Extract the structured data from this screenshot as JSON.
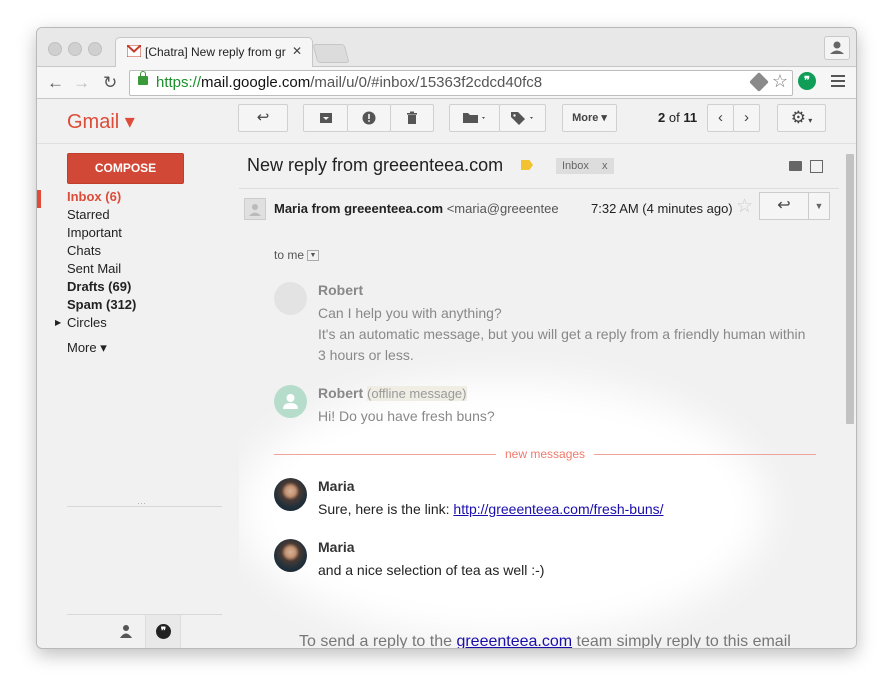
{
  "browser": {
    "tab_title": "[Chatra] New reply from gr",
    "tab_close": "✕",
    "url_scheme": "https://",
    "url_host": "mail.google.com",
    "url_path": "/mail/u/0/#inbox/15363f2cdcd40fc8"
  },
  "gmail": {
    "logo": "Gmail ▾",
    "more_label": "More ▾",
    "count_current": "2",
    "count_of": "of",
    "count_total": "11"
  },
  "sidebar": {
    "compose": "COMPOSE",
    "items": [
      {
        "label": "Inbox (6)"
      },
      {
        "label": "Starred"
      },
      {
        "label": "Important"
      },
      {
        "label": "Chats"
      },
      {
        "label": "Sent Mail"
      },
      {
        "label": "Drafts (69)"
      },
      {
        "label": "Spam (312)"
      },
      {
        "label": "Circles"
      }
    ],
    "more": "More ▾",
    "dots": "···"
  },
  "thread": {
    "subject": "New reply from greeenteea.com",
    "inbox_chip": "Inbox",
    "chip_x": "x",
    "sender_name": "Maria from greeenteea.com",
    "sender_email": "<maria@greeenteea",
    "time": "7:32 AM (4 minutes ago)",
    "to": "to me"
  },
  "conversation": {
    "msg1_name": "Robert",
    "msg1_line1": "Can I help you with anything?",
    "msg1_line2": "It's an automatic message, but you will get a reply from a friendly human within",
    "msg1_line3": "3 hours or less.",
    "msg2_name": "Robert",
    "msg2_offline": "(offline message)",
    "msg2_line1": "Hi! Do you have fresh buns?",
    "new_messages": "new messages",
    "msg3_name": "Maria",
    "msg3_text": "Sure, here is the link: ",
    "msg3_link": "http://greeenteea.com/fresh-buns/",
    "msg4_name": "Maria",
    "msg4_text": "and a nice selection of tea as well :-)"
  },
  "footer": {
    "pre": "To send a reply to the ",
    "link": "greeenteea.com",
    "post": " team simply reply to this email"
  },
  "colors": {
    "gmail_red": "#dd4b39",
    "compose": "#d14836",
    "link": "#1a0dab",
    "new_messages": "#f07a6c",
    "hangouts_green": "#0f9d58",
    "secure_green": "#1b8f2a"
  }
}
